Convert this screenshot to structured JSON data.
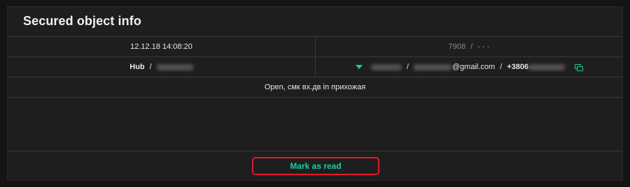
{
  "header": {
    "title": "Secured object info"
  },
  "row1": {
    "datetime": "12.12.18 14:08:20",
    "object_number": "7908",
    "separator": "/",
    "extra": "- - -"
  },
  "row2": {
    "hub_label": "Hub",
    "separator": "/",
    "email_domain": "@gmail.com",
    "phone_prefix": "+3806"
  },
  "row3": {
    "message": "Open, смк вх.дв in прихожая"
  },
  "footer": {
    "mark_as_read_label": "Mark as read"
  },
  "colors": {
    "accent": "#1fc9a0",
    "highlight_border": "#e0192e",
    "panel_bg": "#1e1e1e",
    "page_bg": "#141414"
  },
  "icons": {
    "user_dropdown": "chevron-down-icon",
    "phone_action": "copy-icon"
  }
}
